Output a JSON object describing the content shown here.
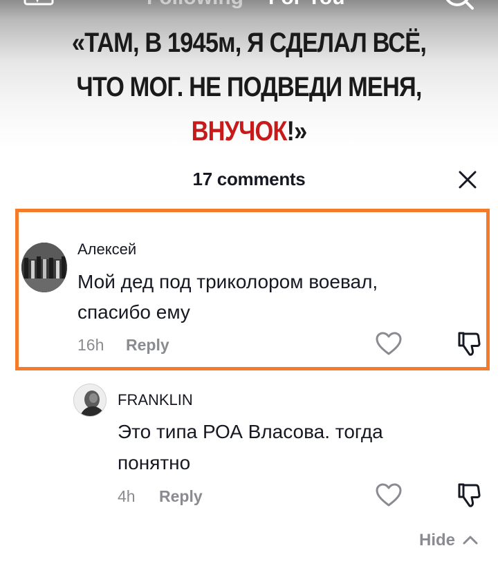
{
  "video": {
    "nav": {
      "live_icon": "live-tv-icon",
      "following_label": "Following",
      "for_you_label": "For You",
      "search_icon": "search-icon"
    },
    "caption": {
      "line1": "«ТАМ, В 1945м, Я СДЕЛАЛ ВСЁ,",
      "line2": "ЧТО МОГ. НЕ ПОДВЕДИ МЕНЯ,",
      "line3_red": "ВНУЧОК",
      "line3_tail": "!»",
      "highlight_color": "#c71a1a"
    }
  },
  "comments_sheet": {
    "title": "17 comments",
    "close_icon": "close-icon",
    "comments": [
      {
        "author": "Алексей",
        "text_line1": "Мой дед под триколором воевал,",
        "text_line2": "спасибо ему",
        "time": "16h",
        "reply_label": "Reply",
        "like_icon": "heart-icon",
        "dislike_icon": "thumbs-down-icon"
      },
      {
        "author": "FRANKLIN",
        "text_line1": "Это типа РОА Власова. тогда",
        "text_line2": "понятно",
        "time": "4h",
        "reply_label": "Reply",
        "like_icon": "heart-icon",
        "dislike_icon": "thumbs-down-icon"
      }
    ],
    "hide_label": "Hide",
    "hide_icon": "chevron-up-icon",
    "highlight_border_color": "#f47b2a"
  }
}
